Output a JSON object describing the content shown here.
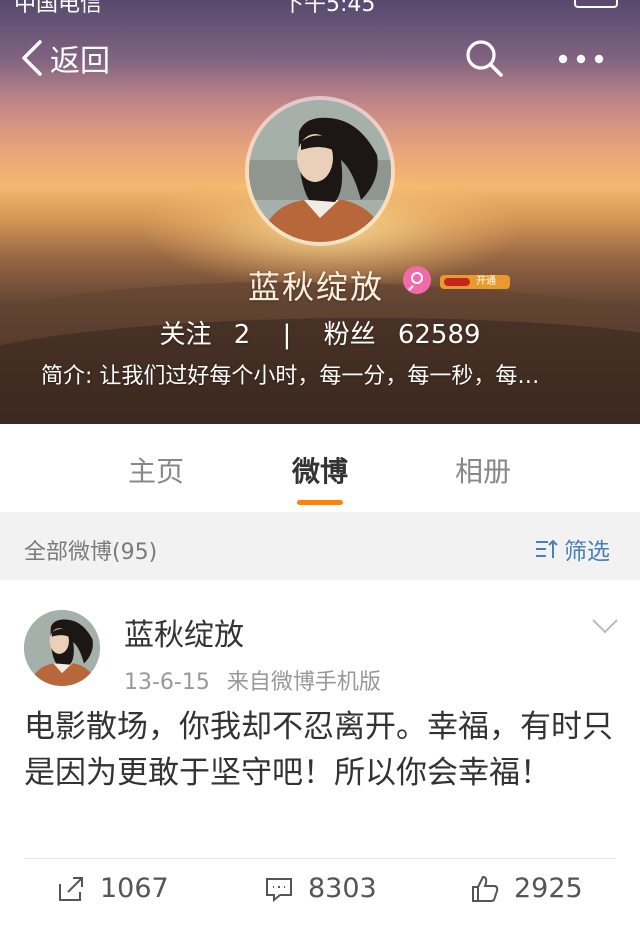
{
  "status_bar": {
    "carrier": "中国电信",
    "time": "下午5:45"
  },
  "header": {
    "back_label": "返回",
    "search_icon": "search-icon",
    "more_icon": "more-dots-icon"
  },
  "profile": {
    "nickname": "蓝秋绽放",
    "gender_icon": "female-icon",
    "vip_label": "开通",
    "following_label": "关注",
    "following_count": "2",
    "separator": "|",
    "followers_label": "粉丝",
    "followers_count": "62589",
    "bio": "简介: 让我们过好每个小时，每一分，每一秒，每…"
  },
  "tabs": [
    {
      "label": "主页",
      "active": false
    },
    {
      "label": "微博",
      "active": true
    },
    {
      "label": "相册",
      "active": false
    }
  ],
  "filter_bar": {
    "count_label": "全部微博(95)",
    "filter_label": "筛选"
  },
  "post": {
    "author": "蓝秋绽放",
    "date": "13-6-15",
    "source": "来自微博手机版",
    "text": "电影散场，你我却不忍离开。幸福，有时只是因为更敢于坚守吧！所以你会幸福！",
    "reposts": "1067",
    "comments": "8303",
    "likes": "2925"
  },
  "colors": {
    "accent": "#ff8200",
    "link": "#4a7fb8",
    "female": "#f36aa8"
  }
}
